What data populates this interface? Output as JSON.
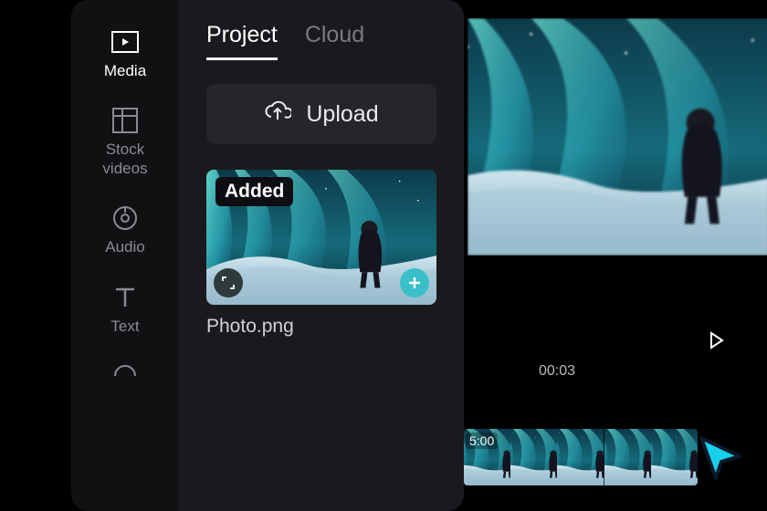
{
  "sidebar": {
    "items": [
      {
        "label": "Media"
      },
      {
        "label": "Stock\nvideos"
      },
      {
        "label": "Audio"
      },
      {
        "label": "Text"
      }
    ]
  },
  "panel": {
    "tabs": [
      {
        "label": "Project"
      },
      {
        "label": "Cloud"
      }
    ],
    "upload_label": "Upload",
    "thumb": {
      "badge": "Added",
      "name": "Photo.png"
    }
  },
  "timeline": {
    "timecodes": [
      "00:03"
    ],
    "clip_time": "5:00"
  },
  "colors": {
    "accent": "#39bfc8"
  }
}
